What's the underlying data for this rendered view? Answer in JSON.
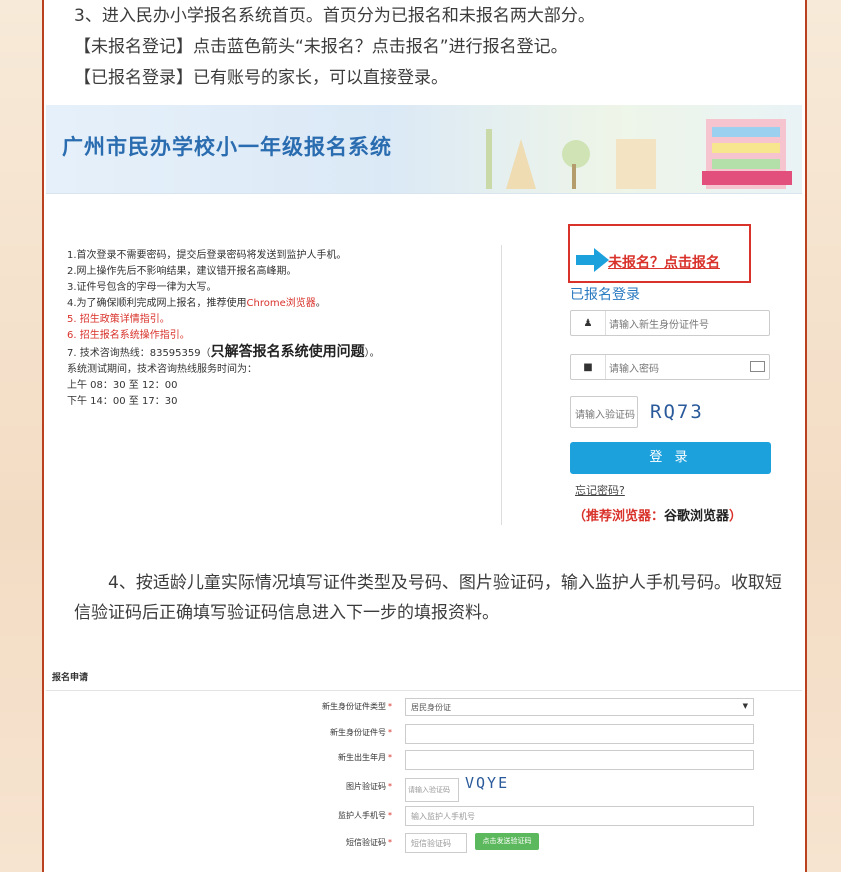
{
  "article": {
    "p1": "3、进入民办小学报名系统首页。首页分为已报名和未报名两大部分。",
    "p2": "【未报名登记】点击蓝色箭头“未报名？点击报名”进行报名登记。",
    "p3": "【已报名登录】已有账号的家长，可以直接登录。",
    "p4": "4、按适龄儿童实际情况填写证件类型及号码、图片验证码，输入监护人手机号码。收取短信验证码后正确填写验证码信息进入下一步的填报资料。"
  },
  "system": {
    "banner_title": "广州市民办学校小一年级报名系统",
    "notes": {
      "n1": "1.首次登录不需要密码，提交后登录密码将发送到监护人手机。",
      "n2": "2.网上操作先后不影响结果，建议错开报名高峰期。",
      "n3": "3.证件号包含的字母一律为大写。",
      "n4_prefix": "4.为了确保顺利完成网上报名，推荐使用",
      "n4_link": "Chrome浏览器",
      "n4_suffix": "。",
      "n5": "5. 招生政策详情指引。",
      "n6": "6. 招生报名系统操作指引。",
      "n7_prefix": "7. 技术咨询热线：83595359（",
      "n7_big": "只解答报名系统使用问题",
      "n7_suffix": "）。",
      "n8": "系统测试期间，技术咨询热线服务时间为：",
      "n9": "上午 08：30 至 12：00",
      "n10": "下午 14：00 至 17：30"
    },
    "register_link": "未报名？点击报名",
    "login_title": "已报名登录",
    "id_placeholder": "请输入新生身份证件号",
    "password_placeholder": "请输入密码",
    "captcha_placeholder": "请输入验证码",
    "captcha_text": "RQ73",
    "login_button": "登 录",
    "forgot_password": "忘记密码?",
    "recommend_prefix": "（推荐浏览器：",
    "recommend_browser": "谷歌浏览器",
    "recommend_suffix": "）"
  },
  "form": {
    "header": "报名申请",
    "doc_type_label": "新生身份证件类型",
    "doc_type_value": "居民身份证",
    "doc_number_label": "新生身份证件号",
    "birth_label": "新生出生年月",
    "image_captcha_label": "图片验证码",
    "image_captcha_placeholder": "请输入验证码",
    "image_captcha_text": "VQYE",
    "phone_label": "监护人手机号",
    "phone_placeholder": "输入监护人手机号",
    "sms_label": "短信验证码",
    "sms_placeholder": "短信验证码",
    "sms_button": "点击发送验证码",
    "required_mark": "*"
  },
  "colors": {
    "border": "#b9411f",
    "accent_blue": "#1ca1dc",
    "alert_red": "#d9322b",
    "sms_green": "#5cb85c"
  }
}
